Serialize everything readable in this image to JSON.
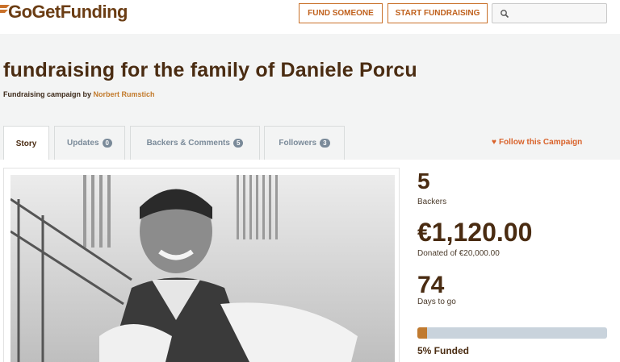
{
  "header": {
    "logo_text": "GoGetFunding",
    "fund_someone_label": "FUND SOMEONE",
    "start_fundraising_label": "START FUNDRAISING",
    "search_placeholder": ""
  },
  "campaign": {
    "title": "fundraising for the family of Daniele Porcu",
    "byline_prefix": "Fundraising campaign by",
    "author": "Norbert Rumstich"
  },
  "tabs": [
    {
      "label": "Story",
      "count": ""
    },
    {
      "label": "Updates",
      "count": "0"
    },
    {
      "label": "Backers & Comments",
      "count": "5"
    },
    {
      "label": "Followers",
      "count": "3"
    }
  ],
  "follow_label": "Follow this Campaign",
  "stats": {
    "backers_value": "5",
    "backers_label": "Backers",
    "amount_value": "€1,120.00",
    "amount_label": "Donated of €20,000.00",
    "days_value": "74",
    "days_label": "Days to go",
    "funded_percent": 5,
    "funded_label": "5% Funded"
  },
  "colors": {
    "brand_brown": "#4a2c12",
    "accent_orange": "#c0611d",
    "progress_fill": "#c07a2f",
    "progress_track": "#c9d3dc"
  }
}
